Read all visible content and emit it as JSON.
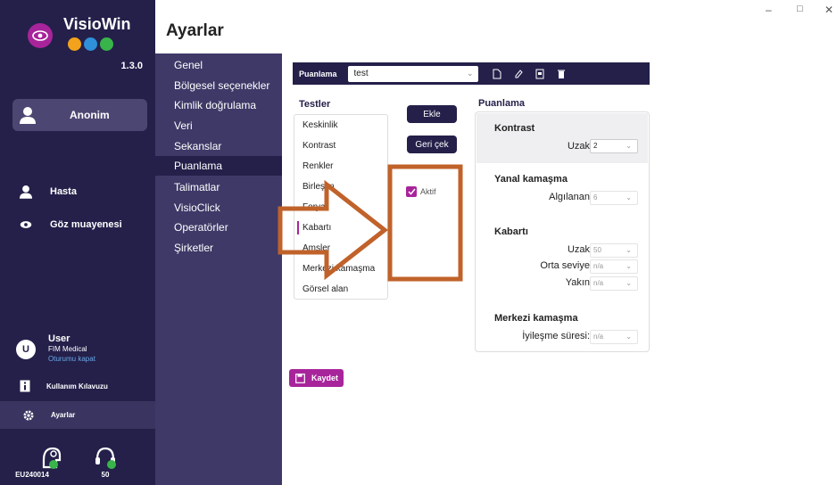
{
  "app": {
    "name": "VisioWin",
    "version": "1.3.0",
    "accent_color": "#a8249b",
    "sidebar_color": "#24204a"
  },
  "sidebar": {
    "profile": {
      "label": "Anonim",
      "icon": "person-icon"
    },
    "nav": [
      {
        "label": "Hasta",
        "icon": "person-icon"
      },
      {
        "label": "Göz muayenesi",
        "icon": "eye-icon"
      }
    ],
    "user": {
      "initial": "U",
      "name": "User",
      "org": "FIM Medical",
      "logout": "Oturumu kapat"
    },
    "manual": {
      "label": "Kullanım Kılavuzu",
      "icon": "info-icon"
    },
    "settings": {
      "label": "Ayarlar",
      "icon": "gear-icon"
    },
    "devices": [
      {
        "label": "EU240014",
        "icon": "device-head-icon"
      },
      {
        "label": "50",
        "icon": "headset-icon"
      }
    ]
  },
  "page": {
    "title": "Ayarlar"
  },
  "subnav": {
    "items": [
      {
        "label": "Genel"
      },
      {
        "label": "Bölgesel seçenekler"
      },
      {
        "label": "Kimlik doğrulama"
      },
      {
        "label": "Veri"
      },
      {
        "label": "Sekanslar"
      },
      {
        "label": "Puanlama",
        "active": true
      },
      {
        "label": "Talimatlar"
      },
      {
        "label": "VisioClick"
      },
      {
        "label": "Operatörler"
      },
      {
        "label": "Şirketler"
      }
    ]
  },
  "toolbar": {
    "label": "Puanlama",
    "select_value": "test"
  },
  "tests": {
    "title": "Testler",
    "items": [
      "Keskinlik",
      "Kontrast",
      "Renkler",
      "Birleşim",
      "Forya",
      "Kabartı",
      "Amsler",
      "Merkezi kamaşma",
      "Görsel alan"
    ],
    "selected_index": 5
  },
  "actions": {
    "add": "Ekle",
    "undo": "Geri çek"
  },
  "active_checkbox": {
    "label": "Aktif",
    "checked": true
  },
  "scoring": {
    "title": "Puanlama",
    "sections": {
      "kontrast": {
        "title": "Kontrast",
        "rows": [
          {
            "label": "Uzak",
            "value": "2"
          }
        ]
      },
      "yanal": {
        "title": "Yanal kamaşma",
        "rows": [
          {
            "label": "Algılanan",
            "value": "6"
          }
        ]
      },
      "kabarti": {
        "title": "Kabartı",
        "rows": [
          {
            "label": "Uzak",
            "value": "50"
          },
          {
            "label": "Orta seviye",
            "value": "n/a"
          },
          {
            "label": "Yakın",
            "value": "n/a"
          }
        ]
      },
      "merkezi": {
        "title": "Merkezi kamaşma",
        "rows": [
          {
            "label": "İyileşme süresi:",
            "value": "n/a"
          }
        ]
      }
    }
  },
  "save": {
    "label": "Kaydet"
  },
  "annotation_color": "#c0622a"
}
